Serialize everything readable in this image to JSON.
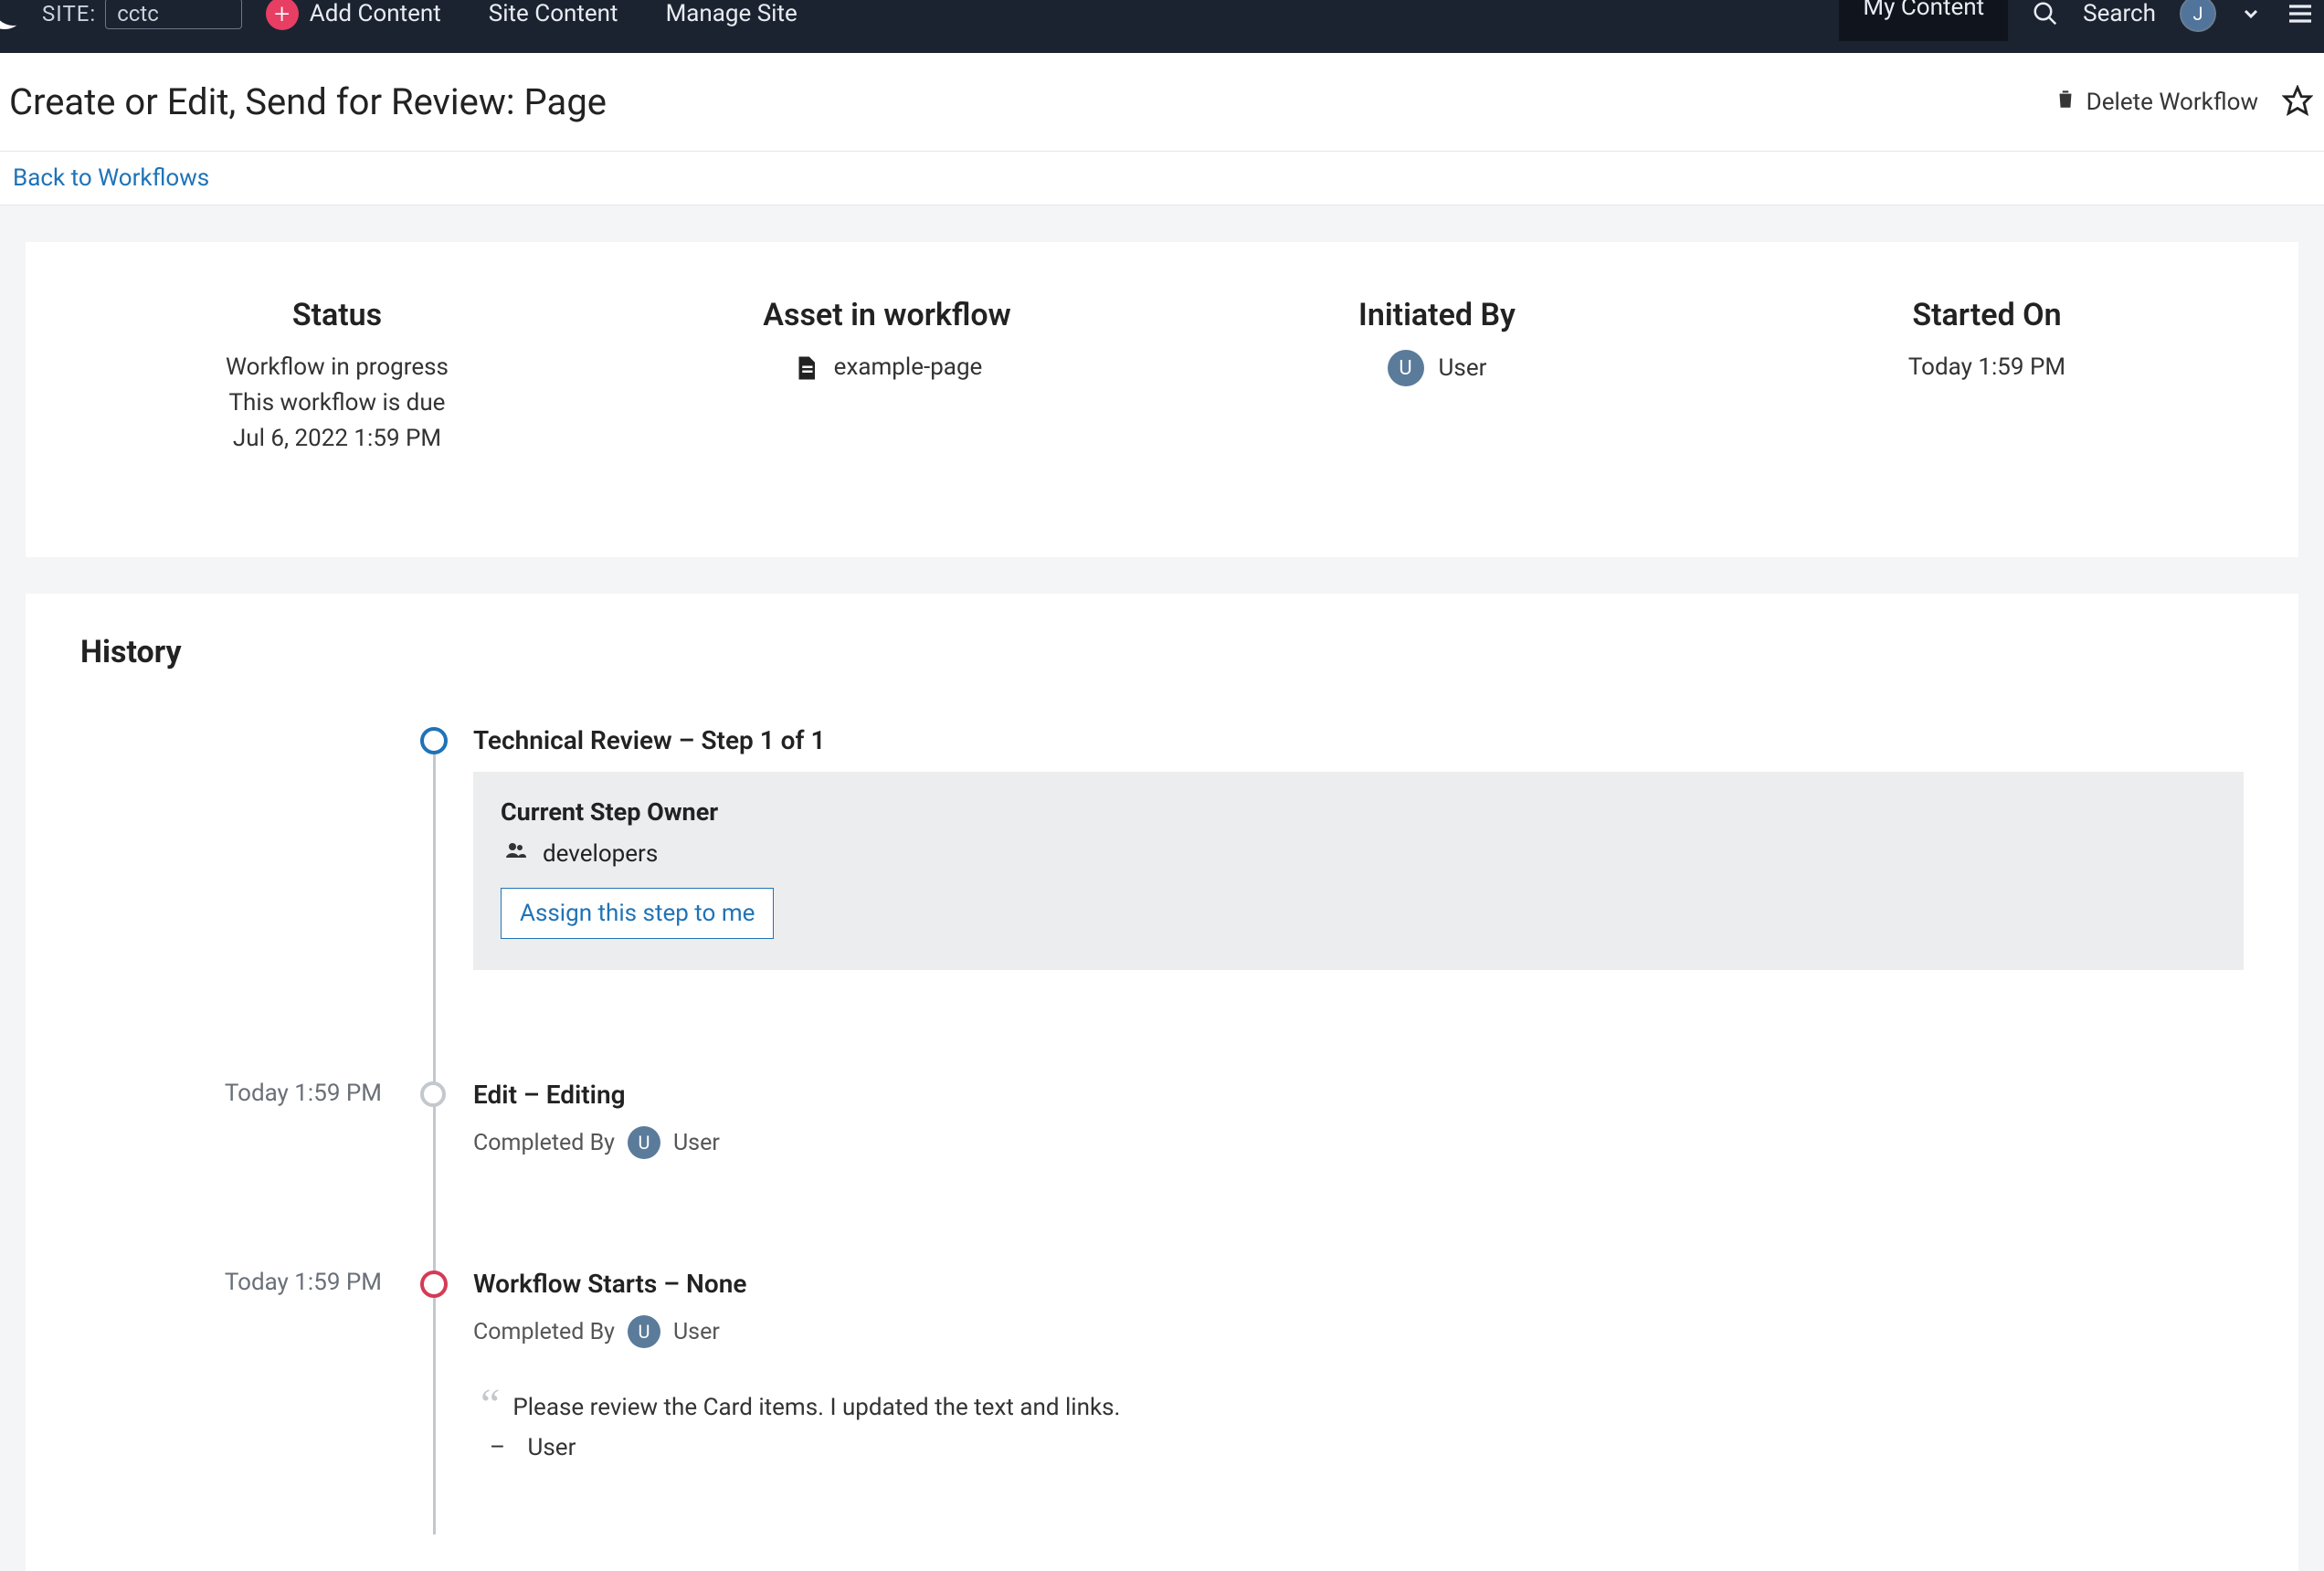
{
  "topbar": {
    "site_label": "SITE:",
    "site_value": "cctc",
    "add_content": "Add Content",
    "site_content": "Site Content",
    "manage_site": "Manage Site",
    "my_content": "My Content",
    "search_label": "Search",
    "user_initial": "J"
  },
  "header": {
    "title": "Create or Edit, Send for Review: Page",
    "delete_label": "Delete Workflow"
  },
  "crumb": {
    "back_label": "Back to Workflows"
  },
  "summary": {
    "status_heading": "Status",
    "status_line1": "Workflow in progress",
    "status_line2": "This workflow is due",
    "status_line3": "Jul 6, 2022 1:59 PM",
    "asset_heading": "Asset in workflow",
    "asset_name": "example-page",
    "initiated_heading": "Initiated By",
    "initiated_avatar": "U",
    "initiated_user": "User",
    "started_heading": "Started On",
    "started_value": "Today 1:59 PM"
  },
  "history": {
    "heading": "History",
    "step1": {
      "title": "Technical Review – Step 1 of 1",
      "owner_heading": "Current Step Owner",
      "owner_name": "developers",
      "assign_label": "Assign this step to me"
    },
    "step2": {
      "time": "Today 1:59 PM",
      "title": "Edit – Editing",
      "completed_label": "Completed By",
      "avatar": "U",
      "user": "User"
    },
    "step3": {
      "time": "Today 1:59 PM",
      "title": "Workflow Starts – None",
      "completed_label": "Completed By",
      "avatar": "U",
      "user": "User",
      "comment": "Please review the Card items. I updated the text and links.",
      "attrib_dash": "–",
      "attrib_name": "User"
    }
  }
}
